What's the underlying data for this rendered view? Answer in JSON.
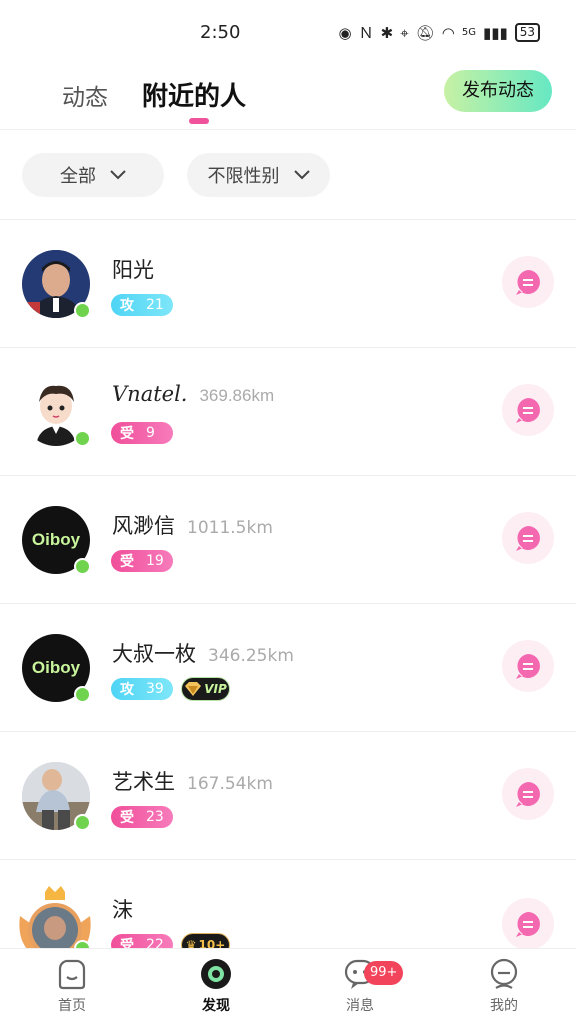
{
  "status_bar": {
    "time": "2:50",
    "network": "5G",
    "battery": "53"
  },
  "header": {
    "tabs": [
      {
        "label": "动态"
      },
      {
        "label": "附近的人",
        "active": true
      }
    ],
    "publish_button": "发布动态"
  },
  "filters": {
    "category": "全部",
    "gender": "不限性别"
  },
  "users": [
    {
      "name": "阳光",
      "distance": "",
      "role": "攻",
      "age": "21",
      "online": true,
      "avatar": "photo-man-suit"
    },
    {
      "name": "Vnatel.",
      "distance": "369.86km",
      "role": "受",
      "age": "9",
      "online": true,
      "avatar": "cartoon-boy"
    },
    {
      "name": "风渺信",
      "distance": "1011.5km",
      "role": "受",
      "age": "19",
      "online": true,
      "avatar": "oiboy-logo",
      "avatar_text": "Oiboy"
    },
    {
      "name": "大叔一枚",
      "distance": "346.25km",
      "role": "攻",
      "age": "39",
      "online": true,
      "avatar": "oiboy-logo",
      "avatar_text": "Oiboy",
      "vip": true
    },
    {
      "name": "艺术生",
      "distance": "167.54km",
      "role": "受",
      "age": "23",
      "online": true,
      "avatar": "photo-sitting"
    },
    {
      "name": "沫",
      "distance": "",
      "role": "受",
      "age": "22",
      "online": true,
      "avatar": "photo-crowned",
      "level_badge": "10+"
    }
  ],
  "bottom_nav": {
    "items": [
      {
        "label": "首页",
        "icon": "home-icon"
      },
      {
        "label": "发现",
        "icon": "discover-icon",
        "active": true
      },
      {
        "label": "消息",
        "icon": "message-icon",
        "badge": "99+"
      },
      {
        "label": "我的",
        "icon": "profile-icon"
      }
    ]
  },
  "colors": {
    "accent_pink": "#f0529b",
    "publish_gradient_start": "#c7f1a4",
    "publish_gradient_end": "#66e8c3",
    "online": "#6fd34d",
    "gong_badge": "#4fd5f5",
    "shou_badge": "#f04f9a"
  }
}
